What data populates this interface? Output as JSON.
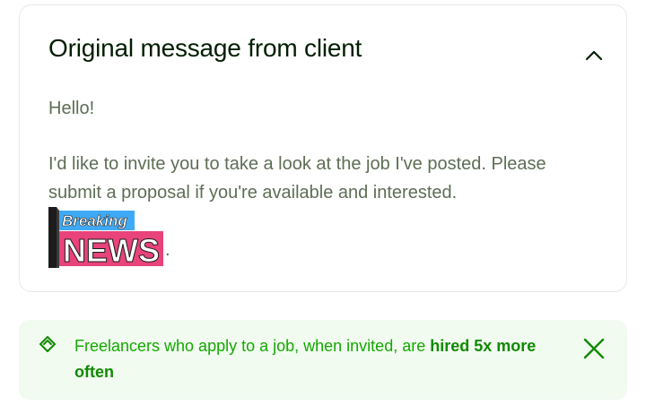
{
  "card": {
    "title": "Original message from client",
    "greeting": "Hello!",
    "body": "I'd like to invite you to take a look at the job I've posted. Please submit a proposal if you're available and interested.",
    "image": {
      "top_text": "Breaking",
      "bottom_text": "NEWS"
    },
    "trailing_period": "."
  },
  "banner": {
    "text": "Freelancers who apply to a job, when invited, are ",
    "highlight": "hired 5x more often"
  },
  "icons": {
    "collapse": "chevron-up-icon",
    "tag": "tag-icon",
    "close": "close-icon"
  },
  "colors": {
    "accent_green": "#14a800",
    "banner_bg": "#f1fbf0",
    "text_muted": "#5e6d55"
  }
}
